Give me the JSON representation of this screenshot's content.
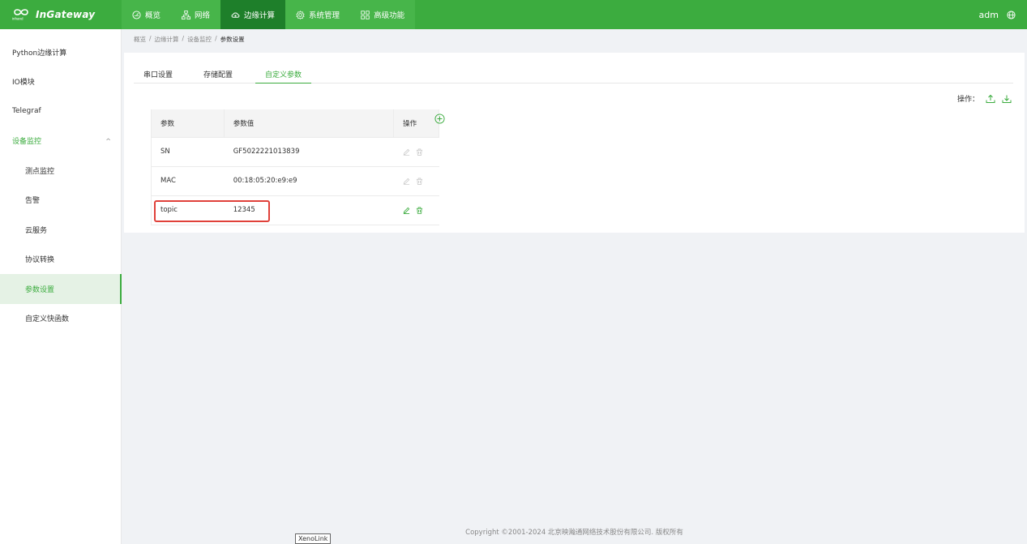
{
  "brand": {
    "name": "InGateway",
    "logo_text": "inhand"
  },
  "nav": [
    {
      "label": "概览",
      "icon": "dashboard-icon"
    },
    {
      "label": "网络",
      "icon": "network-icon"
    },
    {
      "label": "边缘计算",
      "icon": "cloud-icon"
    },
    {
      "label": "系统管理",
      "icon": "gear-icon"
    },
    {
      "label": "高级功能",
      "icon": "grid-icon"
    }
  ],
  "user": {
    "name": "adm"
  },
  "sidebar": {
    "items": [
      {
        "label": "Python边缘计算"
      },
      {
        "label": "IO模块"
      },
      {
        "label": "Telegraf"
      },
      {
        "label": "设备监控"
      },
      {
        "label": "测点监控"
      },
      {
        "label": "告警"
      },
      {
        "label": "云服务"
      },
      {
        "label": "协议转换"
      },
      {
        "label": "参数设置"
      },
      {
        "label": "自定义快函数"
      }
    ]
  },
  "breadcrumb": [
    "概览",
    "边缘计算",
    "设备监控",
    "参数设置"
  ],
  "tabs": [
    {
      "label": "串口设置"
    },
    {
      "label": "存储配置"
    },
    {
      "label": "自定义参数"
    }
  ],
  "ops_label": "操作：",
  "table": {
    "headers": [
      "参数",
      "参数值",
      "操作"
    ],
    "rows": [
      {
        "param": "SN",
        "value": "GF5022221013839"
      },
      {
        "param": "MAC",
        "value": "00:18:05:20:e9:e9"
      },
      {
        "param": "topic",
        "value": "12345"
      }
    ]
  },
  "footer": "Copyright ©2001-2024 北京映瀚通网络技术股份有限公司. 版权所有",
  "tooltip": "XenoLink",
  "colors": {
    "primary": "#3cac3f",
    "active_nav": "#1e7f2a",
    "highlight": "#e0413a"
  }
}
